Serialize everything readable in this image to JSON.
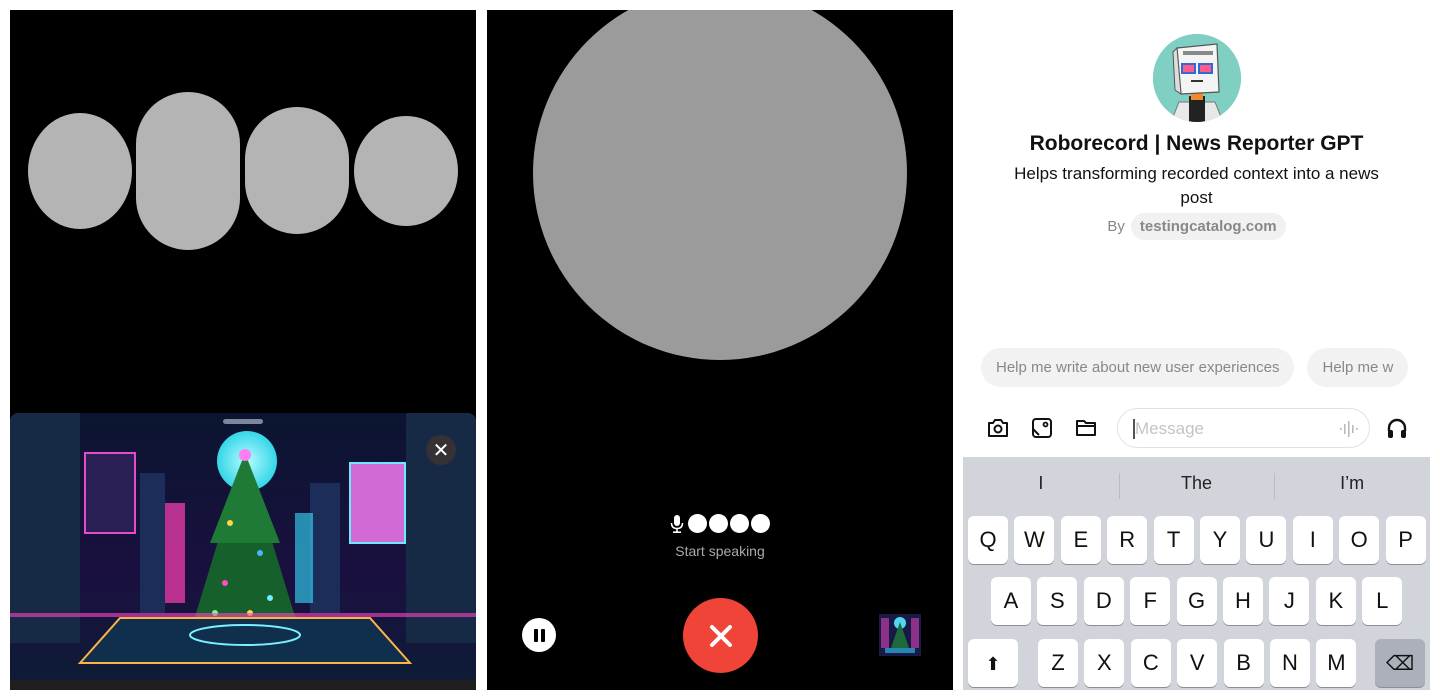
{
  "panel_voice_idle": {
    "blob_count": 4,
    "image_sheet": {
      "image_alt": "Cyberpunk neon city with glowing Christmas tree",
      "close_icon": "close-icon",
      "close_glyph": "✕"
    }
  },
  "panel_voice_active": {
    "mic_icon": "microphone-icon",
    "level_dots": 4,
    "status_text": "Start speaking",
    "pause_icon": "pause-icon",
    "end_call_icon": "close-icon",
    "end_call_color": "#f04438",
    "thumbnail_alt": "Christmas tree image thumbnail"
  },
  "panel_chat": {
    "gpt": {
      "name": "Roborecord | News Reporter GPT",
      "description": "Helps transforming recorded context into a news post",
      "by_label": "By",
      "author": "testingcatalog.com",
      "avatar_bg": "#7fcfc2"
    },
    "suggestions": [
      "Help me write about new user experiences",
      "Help me w"
    ],
    "composer": {
      "camera_icon": "camera-icon",
      "photo_icon": "photo-icon",
      "folder_icon": "folder-icon",
      "placeholder": "Message",
      "waveform_icon": "waveform-icon",
      "headphones_icon": "headphones-icon"
    },
    "keyboard": {
      "predictions": [
        "I",
        "The",
        "I’m"
      ],
      "rows": [
        [
          "Q",
          "W",
          "E",
          "R",
          "T",
          "Y",
          "U",
          "I",
          "O",
          "P"
        ],
        [
          "A",
          "S",
          "D",
          "F",
          "G",
          "H",
          "J",
          "K",
          "L"
        ],
        [
          "Z",
          "X",
          "C",
          "V",
          "B",
          "N",
          "M"
        ]
      ],
      "shift_glyph": "⬆",
      "delete_glyph": "⌫"
    }
  }
}
